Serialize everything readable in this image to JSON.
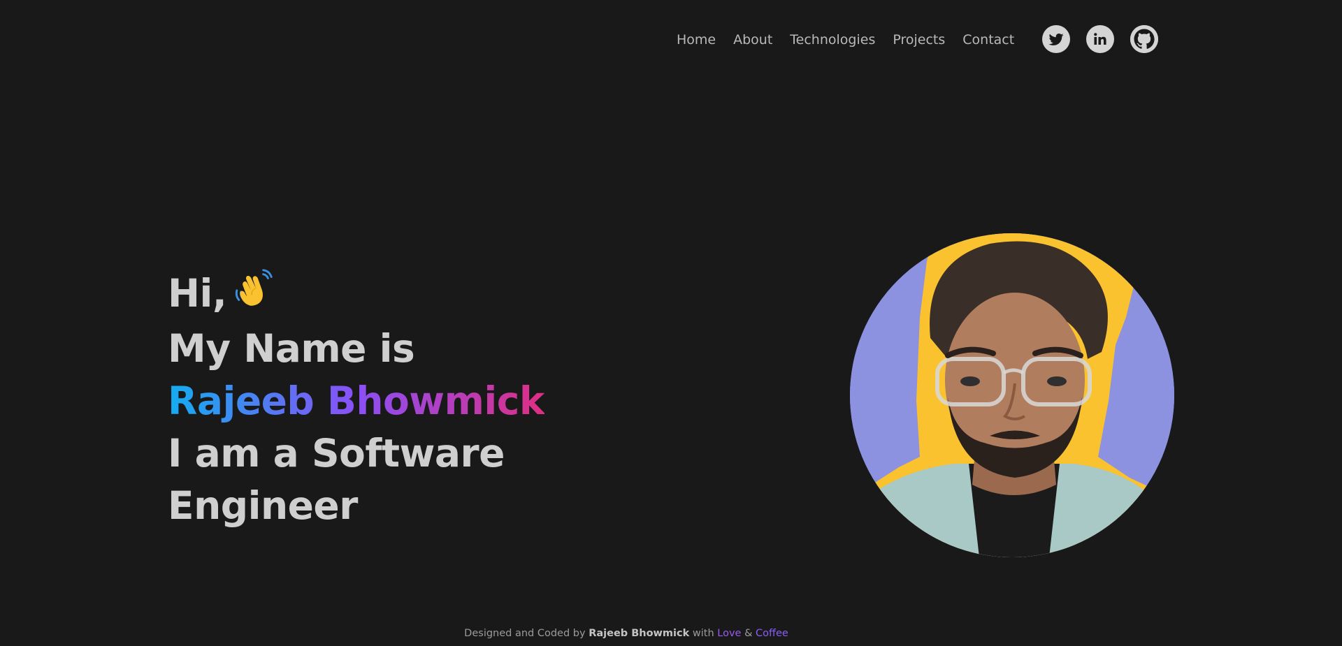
{
  "nav": {
    "items": [
      {
        "label": "Home"
      },
      {
        "label": "About"
      },
      {
        "label": "Technologies"
      },
      {
        "label": "Projects"
      },
      {
        "label": "Contact"
      }
    ]
  },
  "socials": [
    {
      "icon": "twitter-icon"
    },
    {
      "icon": "linkedin-icon"
    },
    {
      "icon": "github-icon"
    }
  ],
  "hero": {
    "greeting": "Hi,",
    "wave_icon": "waving-hand-icon",
    "line2": "My Name is",
    "name": "Rajeeb Bhowmick",
    "line4": "I am a Software",
    "line5": "Engineer"
  },
  "footer": {
    "prefix": "Designed and Coded by",
    "author": "Rajeeb Bhowmick",
    "with": "with",
    "love": "Love",
    "amp": "&",
    "coffee": "Coffee"
  },
  "colors": {
    "background": "#191919",
    "text": "#cfcfcf",
    "gradient_start": "#13adf0",
    "gradient_mid": "#8a4ff6",
    "gradient_end": "#dd2f84",
    "portrait_bg": "#8c92e0",
    "portrait_outline": "#f9c22e"
  }
}
